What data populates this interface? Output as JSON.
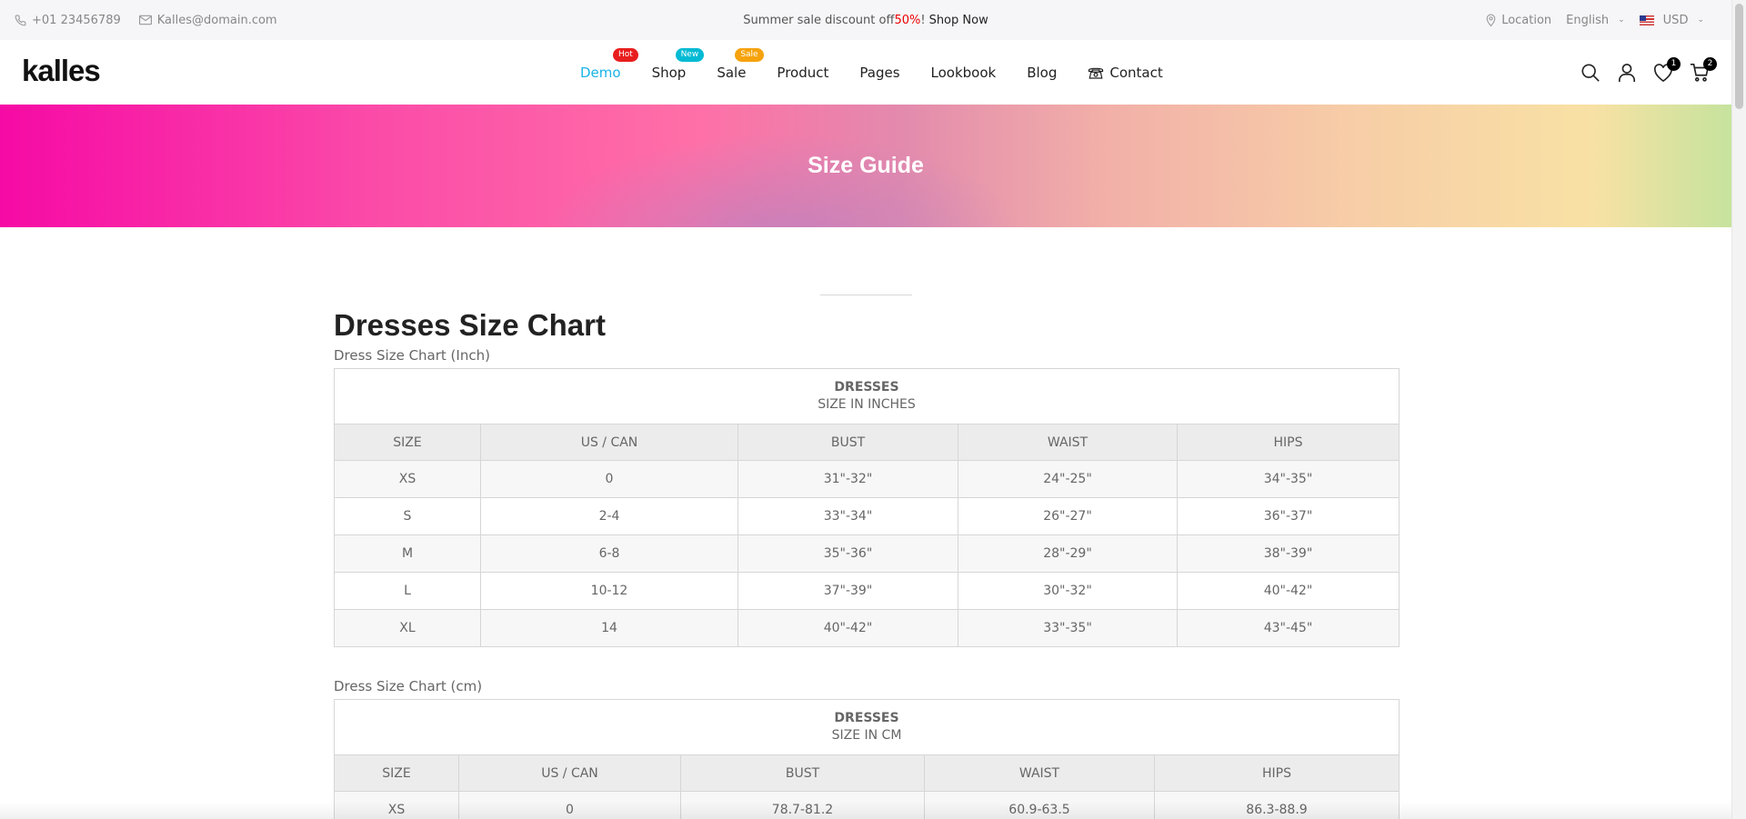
{
  "topbar": {
    "phone": "+01 23456789",
    "email": "Kalles@domain.com",
    "promo_text": "Summer sale discount off ",
    "promo_pct": "50%",
    "promo_bang": "!",
    "promo_link": "Shop Now",
    "location": "Location",
    "language": "English",
    "currency": "USD"
  },
  "header": {
    "logo": "kalles",
    "nav": [
      {
        "label": "Demo",
        "badge": "Hot"
      },
      {
        "label": "Shop",
        "badge": "New"
      },
      {
        "label": "Sale",
        "badge": "Sale"
      },
      {
        "label": "Product"
      },
      {
        "label": "Pages"
      },
      {
        "label": "Lookbook"
      },
      {
        "label": "Blog"
      },
      {
        "label": "Contact"
      }
    ],
    "wishlist_count": "1",
    "cart_count": "2"
  },
  "hero": {
    "title": "Size Guide"
  },
  "colors": {
    "accent": "#1ab3e8",
    "hot": "#e81e1e",
    "new": "#01bad4",
    "sale": "#f6a20c",
    "promo": "#ec0101"
  },
  "main": {
    "title": "Dresses Size Chart",
    "inch": {
      "subtitle": "Dress Size Chart (Inch)",
      "cap1": "DRESSES",
      "cap2": "SIZE IN INCHES",
      "headers": [
        "SIZE",
        "US / CAN",
        "BUST",
        "WAIST",
        "HIPS"
      ],
      "rows": [
        [
          "XS",
          "0",
          "31\"-32\"",
          "24\"-25\"",
          "34\"-35\""
        ],
        [
          "S",
          "2-4",
          "33\"-34\"",
          "26\"-27\"",
          "36\"-37\""
        ],
        [
          "M",
          "6-8",
          "35\"-36\"",
          "28\"-29\"",
          "38\"-39\""
        ],
        [
          "L",
          "10-12",
          "37\"-39\"",
          "30\"-32\"",
          "40\"-42\""
        ],
        [
          "XL",
          "14",
          "40\"-42\"",
          "33\"-35\"",
          "43\"-45\""
        ]
      ]
    },
    "cm": {
      "subtitle": "Dress Size Chart (cm)",
      "cap1": "DRESSES",
      "cap2": "SIZE IN CM",
      "headers": [
        "SIZE",
        "US / CAN",
        "BUST",
        "WAIST",
        "HIPS"
      ],
      "rows": [
        [
          "XS",
          "0",
          "78.7-81.2",
          "60.9-63.5",
          "86.3-88.9"
        ]
      ]
    }
  }
}
